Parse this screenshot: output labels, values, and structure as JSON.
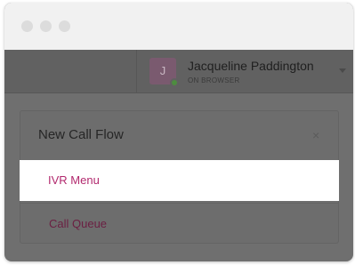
{
  "user": {
    "avatar_initial": "J",
    "name": "Jacqueline Paddington",
    "status": "ON BROWSER"
  },
  "dialog": {
    "title": "New Call Flow",
    "close_symbol": "×",
    "items": [
      {
        "label": "IVR Menu"
      },
      {
        "label": "Call Queue"
      }
    ]
  },
  "colors": {
    "accent": "#b2296e",
    "status_online": "#4d8d3f",
    "overlay": "#6f6f6f"
  }
}
